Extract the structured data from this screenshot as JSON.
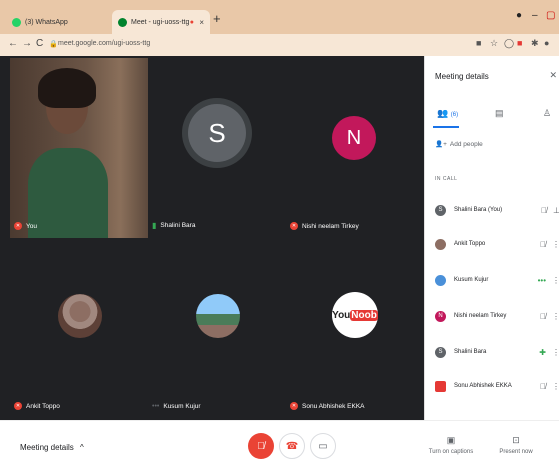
{
  "browser": {
    "tabs": [
      {
        "title": "(3) WhatsApp",
        "favicon_color": "#25d366",
        "close": "×"
      },
      {
        "title": "Meet - ugi-uoss-ttg",
        "favicon_color": "#00832d",
        "close": "×",
        "recording_dot": "●"
      }
    ],
    "new_tab_label": "+",
    "url": "meet.google.com/ugi-uoss-ttg",
    "nav": {
      "back": "←",
      "forward": "→",
      "reload": "C"
    }
  },
  "tiles": [
    {
      "name": "You",
      "kind": "camera",
      "muted": true
    },
    {
      "name": "Shalini Bara",
      "kind": "avatar",
      "letter": "S",
      "color": "#5f6368",
      "speaking": true
    },
    {
      "name": "Nishi neelam Tirkey",
      "kind": "avatar",
      "letter": "N",
      "color": "#c2185b",
      "muted": true
    },
    {
      "name": "Ankit Toppo",
      "kind": "photo",
      "muted": true
    },
    {
      "name": "Kusum Kujur",
      "kind": "photo",
      "muted": false
    },
    {
      "name": "Sonu Abhishek EKKA",
      "kind": "logo",
      "logo_text_1": "You",
      "logo_text_2": "Noob",
      "muted": true
    }
  ],
  "panel": {
    "title": "Meeting details",
    "tab_people_count": "(6)",
    "add_people": "Add people",
    "in_call": "IN CALL",
    "participants": [
      {
        "name": "Shalini Bara (You)",
        "avatar": "S",
        "color": "#5f6368"
      },
      {
        "name": "Ankit Toppo",
        "avatar": "",
        "color": "#8d6e63"
      },
      {
        "name": "Kusum Kujur",
        "avatar": "",
        "color": "#4a90d9"
      },
      {
        "name": "Nishi neelam Tirkey",
        "avatar": "N",
        "color": "#c2185b"
      },
      {
        "name": "Shalini Bara",
        "avatar": "S",
        "color": "#5f6368"
      },
      {
        "name": "Sonu Abhishek EKKA",
        "avatar": "",
        "color": "#e53935"
      }
    ]
  },
  "bottom": {
    "meeting_details": "Meeting details",
    "captions": "Turn on captions",
    "present": "Present now"
  }
}
